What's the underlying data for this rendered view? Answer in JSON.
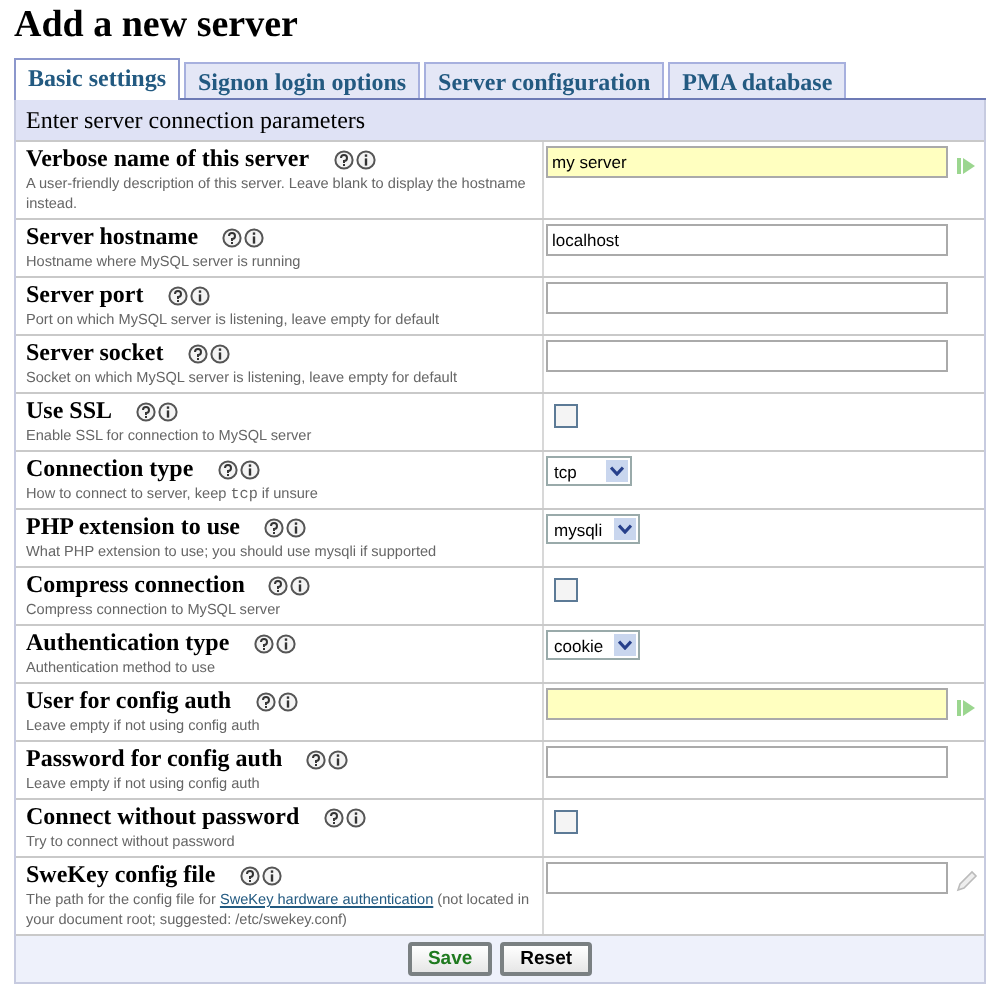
{
  "page_title": "Add a new server",
  "tabs": [
    {
      "label": "Basic settings",
      "selected": true
    },
    {
      "label": "Signon login options",
      "selected": false
    },
    {
      "label": "Server configuration",
      "selected": false
    },
    {
      "label": "PMA database",
      "selected": false
    }
  ],
  "section_header": "Enter server connection parameters",
  "fields": [
    {
      "kind": "text",
      "label": "Verbose name of this server",
      "description": [
        {
          "kind": "plain",
          "text": "A user-friendly description of this server. Leave blank to display the hostname instead."
        }
      ],
      "value": "my server",
      "changed": true
    },
    {
      "kind": "text",
      "label": "Server hostname",
      "description": [
        {
          "kind": "plain",
          "text": "Hostname where MySQL server is running"
        }
      ],
      "value": "localhost",
      "changed": false
    },
    {
      "kind": "text",
      "label": "Server port",
      "description": [
        {
          "kind": "plain",
          "text": "Port on which MySQL server is listening, leave empty for default"
        }
      ],
      "changed": false
    },
    {
      "kind": "text",
      "label": "Server socket",
      "description": [
        {
          "kind": "plain",
          "text": "Socket on which MySQL server is listening, leave empty for default"
        }
      ],
      "changed": false
    },
    {
      "kind": "checkbox",
      "label": "Use SSL",
      "description": [
        {
          "kind": "plain",
          "text": "Enable SSL for connection to MySQL server"
        }
      ],
      "checked": false
    },
    {
      "kind": "select",
      "label": "Connection type",
      "description": [
        {
          "kind": "plain",
          "text": "How to connect to server, keep "
        },
        {
          "kind": "code",
          "text": "tcp"
        },
        {
          "kind": "plain",
          "text": " if unsure"
        }
      ],
      "value": "tcp"
    },
    {
      "kind": "select",
      "label": "PHP extension to use",
      "description": [
        {
          "kind": "plain",
          "text": "What PHP extension to use; you should use mysqli if supported"
        }
      ],
      "value": "mysqli"
    },
    {
      "kind": "checkbox",
      "label": "Compress connection",
      "description": [
        {
          "kind": "plain",
          "text": "Compress connection to MySQL server"
        }
      ],
      "checked": false
    },
    {
      "kind": "select",
      "label": "Authentication type",
      "description": [
        {
          "kind": "plain",
          "text": "Authentication method to use"
        }
      ],
      "value": "cookie"
    },
    {
      "kind": "text",
      "label": "User for config auth",
      "description": [
        {
          "kind": "plain",
          "text": "Leave empty if not using config auth"
        }
      ],
      "changed": true
    },
    {
      "kind": "text",
      "label": "Password for config auth",
      "description": [
        {
          "kind": "plain",
          "text": "Leave empty if not using config auth"
        }
      ],
      "changed": false
    },
    {
      "kind": "checkbox",
      "label": "Connect without password",
      "description": [
        {
          "kind": "plain",
          "text": "Try to connect without password"
        }
      ],
      "checked": false
    },
    {
      "kind": "path",
      "label": "SweKey config file",
      "description": [
        {
          "kind": "plain",
          "text": "The path for the config file for "
        },
        {
          "kind": "link",
          "text": "SweKey hardware authentication"
        },
        {
          "kind": "plain",
          "text": " (not located in your document root; suggested: /etc/swekey.conf)"
        }
      ]
    }
  ],
  "buttons": [
    {
      "label": "Save",
      "kind": "primary"
    },
    {
      "label": "Reset",
      "kind": "secondary"
    }
  ]
}
